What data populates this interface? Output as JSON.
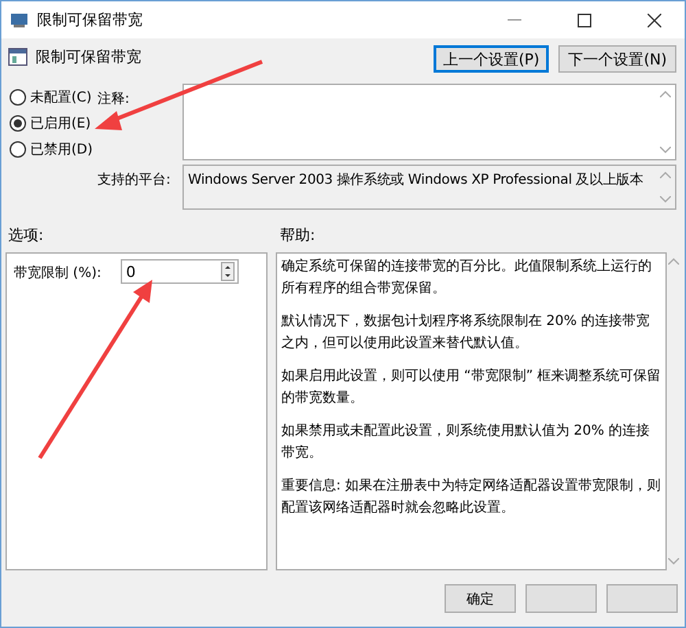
{
  "window": {
    "title": "限制可保留带宽"
  },
  "header": {
    "title": "限制可保留带宽"
  },
  "nav_buttons": [
    {
      "label": "上一个设置(P)",
      "focused": true
    },
    {
      "label": "下一个设置(N)",
      "focused": false
    }
  ],
  "radios": [
    {
      "label": "未配置(C)",
      "selected": false
    },
    {
      "label": "已启用(E)",
      "selected": true
    },
    {
      "label": "已禁用(D)",
      "selected": false
    }
  ],
  "comment": {
    "label": "注释:"
  },
  "platform": {
    "label": "支持的平台:",
    "value": "Windows Server 2003 操作系统或 Windows XP Professional 及以上版本"
  },
  "options": {
    "heading": "选项:",
    "field": {
      "label": "带宽限制 (%):",
      "value": "0"
    }
  },
  "help": {
    "heading": "帮助:",
    "paragraphs": [
      "确定系统可保留的连接带宽的百分比。此值限制系统上运行的所有程序的组合带宽保留。",
      "默认情况下，数据包计划程序将系统限制在 20% 的连接带宽之内，但可以使用此设置来替代默认值。",
      "如果启用此设置，则可以使用 “带宽限制” 框来调整系统可保留的带宽数量。",
      "如果禁用或未配置此设置，则系统使用默认值为 20% 的连接带宽。",
      "重要信息: 如果在注册表中为特定网络适配器设置带宽限制，则配置该网络适配器时就会忽略此设置。"
    ]
  },
  "buttons": [
    {
      "label": "确定"
    }
  ]
}
